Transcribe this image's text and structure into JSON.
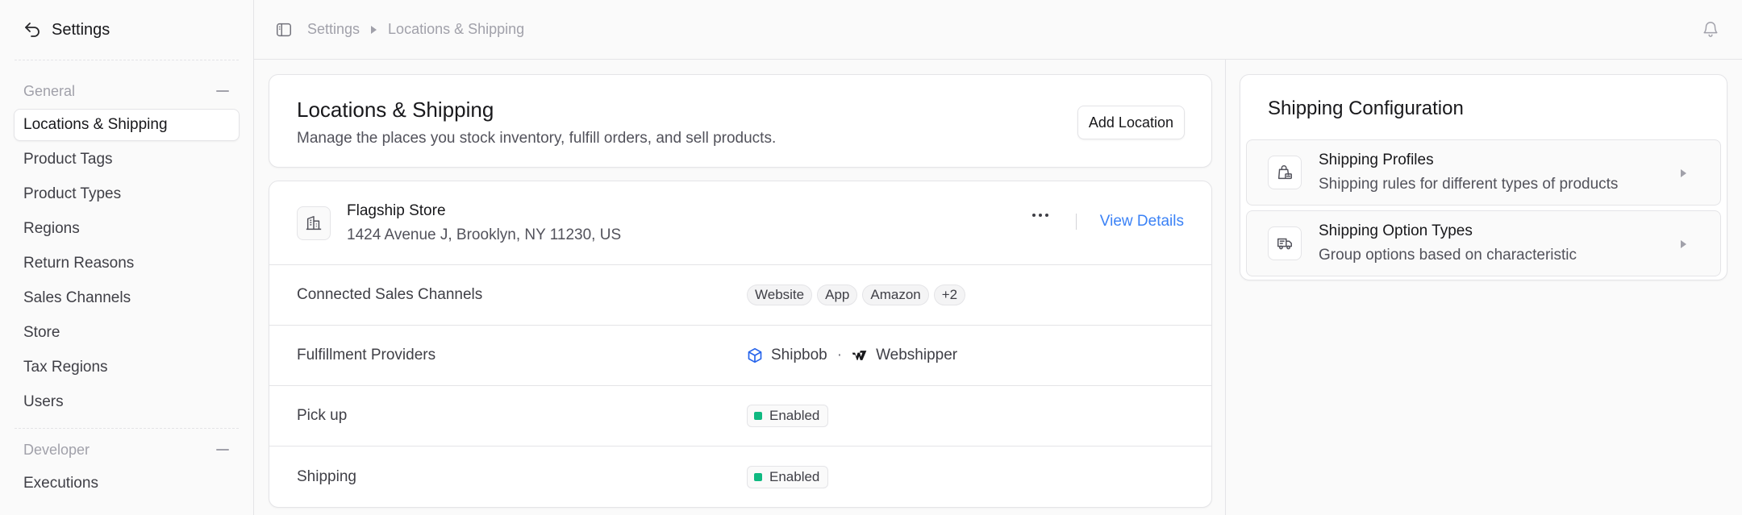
{
  "sidebar": {
    "title": "Settings",
    "groups": [
      {
        "label": "General",
        "items": [
          {
            "label": "Locations & Shipping",
            "active": true
          },
          {
            "label": "Product Tags"
          },
          {
            "label": "Product Types"
          },
          {
            "label": "Regions"
          },
          {
            "label": "Return Reasons"
          },
          {
            "label": "Sales Channels"
          },
          {
            "label": "Store"
          },
          {
            "label": "Tax Regions"
          },
          {
            "label": "Users"
          }
        ]
      },
      {
        "label": "Developer",
        "items": [
          {
            "label": "Executions"
          }
        ]
      }
    ]
  },
  "breadcrumb": {
    "root": "Settings",
    "current": "Locations & Shipping"
  },
  "page": {
    "title": "Locations & Shipping",
    "subtitle": "Manage the places you stock inventory, fulfill orders, and sell products.",
    "add_button": "Add Location"
  },
  "location": {
    "name": "Flagship Store",
    "address": "1424 Avenue J, Brooklyn, NY 11230, US",
    "view_link": "View Details",
    "rows": {
      "sales_channels": {
        "label": "Connected Sales Channels",
        "chips": [
          "Website",
          "App",
          "Amazon",
          "+2"
        ]
      },
      "fulfillment": {
        "label": "Fulfillment Providers",
        "providers": [
          "Shipbob",
          "Webshipper"
        ],
        "separator": "·"
      },
      "pickup": {
        "label": "Pick up",
        "status": "Enabled"
      },
      "shipping": {
        "label": "Shipping",
        "status": "Enabled"
      }
    }
  },
  "config": {
    "title": "Shipping Configuration",
    "items": [
      {
        "name": "Shipping Profiles",
        "desc": "Shipping rules for different types of products"
      },
      {
        "name": "Shipping Option Types",
        "desc": "Group options based on characteristic"
      }
    ]
  },
  "colors": {
    "accent": "#3b82f6",
    "enabled": "#10b981",
    "border": "#e4e4e7"
  }
}
